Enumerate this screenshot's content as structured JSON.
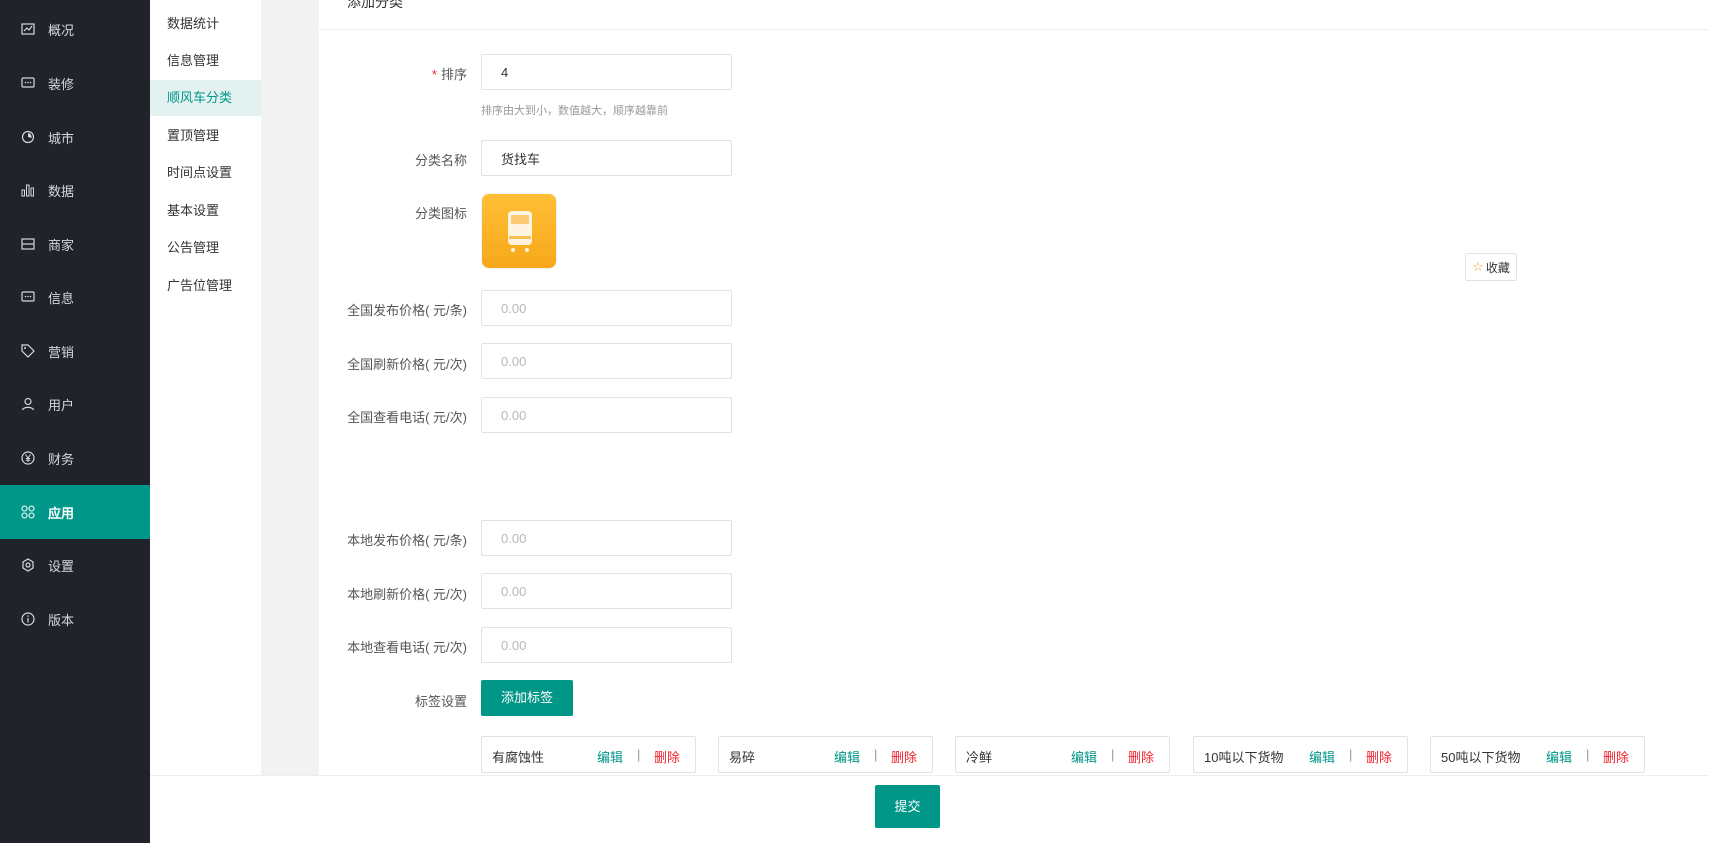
{
  "sidebar": {
    "items": [
      {
        "label": "概况",
        "icon": "overview-icon"
      },
      {
        "label": "装修",
        "icon": "decoration-icon"
      },
      {
        "label": "城市",
        "icon": "city-icon"
      },
      {
        "label": "数据",
        "icon": "chart-icon"
      },
      {
        "label": "商家",
        "icon": "store-icon"
      },
      {
        "label": "信息",
        "icon": "message-icon"
      },
      {
        "label": "营销",
        "icon": "tag-icon"
      },
      {
        "label": "用户",
        "icon": "user-icon"
      },
      {
        "label": "财务",
        "icon": "yen-icon"
      },
      {
        "label": "应用",
        "icon": "apps-icon"
      },
      {
        "label": "设置",
        "icon": "settings-icon"
      },
      {
        "label": "版本",
        "icon": "info-icon"
      }
    ],
    "active": "应用"
  },
  "submenu": {
    "items": [
      "数据统计",
      "信息管理",
      "顺风车分类",
      "置顶管理",
      "时间点设置",
      "基本设置",
      "公告管理",
      "广告位管理"
    ],
    "active": "顺风车分类"
  },
  "header": {
    "title": "添加分类"
  },
  "form": {
    "sort": {
      "label": "排序",
      "value": "4",
      "hint": "排序由大到小，数值越大，顺序越靠前"
    },
    "name": {
      "label": "分类名称",
      "value": "货找车"
    },
    "icon": {
      "label": "分类图标"
    },
    "national_publish": {
      "label": "全国发布价格( 元/条)",
      "placeholder": "0.00"
    },
    "national_refresh": {
      "label": "全国刷新价格( 元/次)",
      "placeholder": "0.00"
    },
    "national_phone": {
      "label": "全国查看电话( 元/次)",
      "placeholder": "0.00"
    },
    "local_publish": {
      "label": "本地发布价格( 元/条)",
      "placeholder": "0.00"
    },
    "local_refresh": {
      "label": "本地刷新价格( 元/次)",
      "placeholder": "0.00"
    },
    "local_phone": {
      "label": "本地查看电话( 元/次)",
      "placeholder": "0.00"
    },
    "tags": {
      "label": "标签设置",
      "add_button": "添加标签"
    }
  },
  "tags": [
    {
      "name": "有腐蚀性",
      "edit": "编辑",
      "sep": "|",
      "del": "删除"
    },
    {
      "name": "易碎",
      "edit": "编辑",
      "sep": "|",
      "del": "删除"
    },
    {
      "name": "冷鲜",
      "edit": "编辑",
      "sep": "|",
      "del": "删除"
    },
    {
      "name": "10吨以下货物",
      "edit": "编辑",
      "sep": "|",
      "del": "删除"
    },
    {
      "name": "50吨以下货物",
      "edit": "编辑",
      "sep": "|",
      "del": "删除"
    }
  ],
  "favorite": {
    "label": "收藏"
  },
  "footer": {
    "submit": "提交"
  },
  "colors": {
    "sidebar_bg": "#20232a",
    "accent": "#009688",
    "danger": "#f5222d",
    "icon_bg": "#f7a81b"
  }
}
